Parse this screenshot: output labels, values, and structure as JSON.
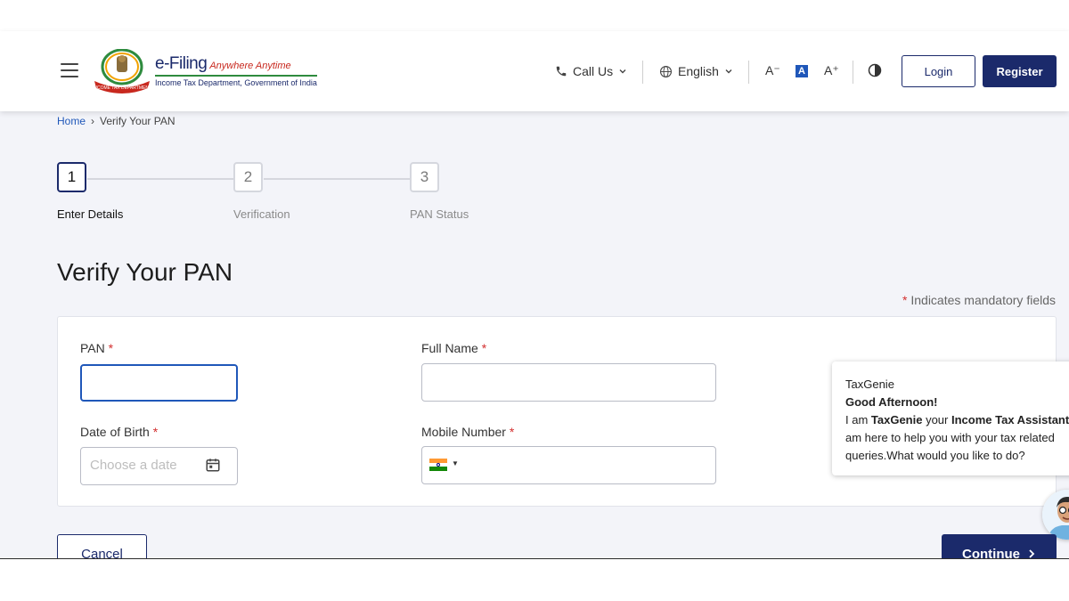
{
  "header": {
    "logo": {
      "brand": "e-Filing",
      "tagline": "Anywhere Anytime",
      "subtitle": "Income Tax Department, Government of India"
    },
    "call_us": "Call Us",
    "language": "English",
    "font_decrease": "A⁻",
    "font_normal": "A",
    "font_increase": "A⁺",
    "login": "Login",
    "register": "Register"
  },
  "breadcrumb": {
    "home": "Home",
    "separator": "›",
    "current": "Verify Your PAN"
  },
  "stepper": {
    "steps": [
      {
        "number": "1",
        "label": "Enter Details",
        "active": true
      },
      {
        "number": "2",
        "label": "Verification",
        "active": false
      },
      {
        "number": "3",
        "label": "PAN Status",
        "active": false
      }
    ]
  },
  "page": {
    "title": "Verify Your PAN",
    "mandatory_asterisk": "*",
    "mandatory_note": " Indicates mandatory fields"
  },
  "form": {
    "pan_label": "PAN",
    "pan_value": "",
    "full_name_label": "Full Name",
    "full_name_value": "",
    "dob_label": "Date of Birth",
    "dob_placeholder": "Choose a date",
    "mobile_label": "Mobile Number",
    "mobile_value": "",
    "required_mark": "*"
  },
  "chat": {
    "title": "TaxGenie",
    "greeting": "Good Afternoon!",
    "msg_prefix": "I am ",
    "msg_bot": "TaxGenie",
    "msg_mid": " your ",
    "msg_role": "Income Tax Assistant",
    "msg_rest": "am here to help you with your tax related queries.What would you like to do?"
  },
  "actions": {
    "cancel": "Cancel",
    "continue": "Continue"
  },
  "colors": {
    "primary": "#1b2a6b",
    "accent_blue": "#1f57b9",
    "required": "#d32f2f",
    "page_bg": "#f3f4f9"
  }
}
